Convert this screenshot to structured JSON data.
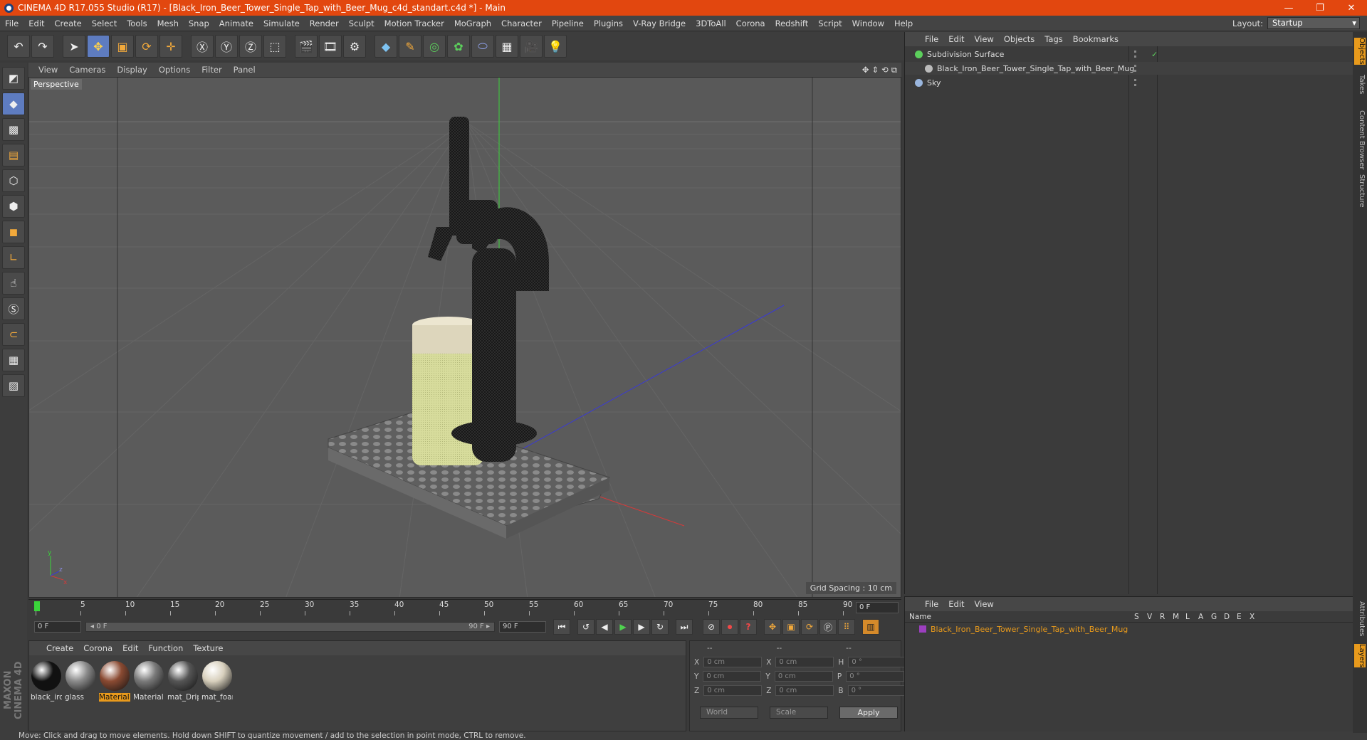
{
  "title": "CINEMA 4D R17.055 Studio (R17) - [Black_Iron_Beer_Tower_Single_Tap_with_Beer_Mug_c4d_standart.c4d *] - Main",
  "menus": [
    "File",
    "Edit",
    "Create",
    "Select",
    "Tools",
    "Mesh",
    "Snap",
    "Animate",
    "Simulate",
    "Render",
    "Sculpt",
    "Motion Tracker",
    "MoGraph",
    "Character",
    "Pipeline",
    "Plugins",
    "V-Ray Bridge",
    "3DToAll",
    "Corona",
    "Redshift",
    "Script",
    "Window",
    "Help"
  ],
  "layout": {
    "label": "Layout:",
    "value": "Startup"
  },
  "viewport": {
    "menus": [
      "View",
      "Cameras",
      "Display",
      "Options",
      "Filter",
      "Panel"
    ],
    "label": "Perspective",
    "grid_spacing": "Grid Spacing : 10 cm"
  },
  "timeline": {
    "ticks": [
      "0",
      "5",
      "10",
      "15",
      "20",
      "25",
      "30",
      "35",
      "40",
      "45",
      "50",
      "55",
      "60",
      "65",
      "70",
      "75",
      "80",
      "85",
      "90"
    ],
    "current_frame": "0 F",
    "start_field": "0 F",
    "slider_start": "◂ 0 F",
    "slider_end": "90 F ▸",
    "end_field": "90 F"
  },
  "material_manager": {
    "menus": [
      "Create",
      "Corona",
      "Edit",
      "Function",
      "Texture"
    ],
    "materials": [
      {
        "name": "black_iron",
        "color": "#111111"
      },
      {
        "name": "glass",
        "color": "#8a8a8a"
      },
      {
        "name": "Material",
        "color": "#8a4a32"
      },
      {
        "name": "Material",
        "color": "#7a7a7a"
      },
      {
        "name": "mat_Drip",
        "color": "#555555"
      },
      {
        "name": "mat_foam",
        "color": "#d8d0bd"
      }
    ]
  },
  "coords": {
    "headers": [
      "--",
      "--",
      "--"
    ],
    "rows": [
      {
        "a": "X",
        "av": "0 cm",
        "b": "X",
        "bv": "0 cm",
        "c": "H",
        "cv": "0 °"
      },
      {
        "a": "Y",
        "av": "0 cm",
        "b": "Y",
        "bv": "0 cm",
        "c": "P",
        "cv": "0 °"
      },
      {
        "a": "Z",
        "av": "0 cm",
        "b": "Z",
        "bv": "0 cm",
        "c": "B",
        "cv": "0 °"
      }
    ],
    "space": "World",
    "mode": "Scale",
    "apply": "Apply"
  },
  "object_manager": {
    "menus": [
      "File",
      "Edit",
      "View",
      "Objects",
      "Tags",
      "Bookmarks"
    ],
    "objects": [
      {
        "name": "Subdivision Surface",
        "icon_color": "#5ccf5c"
      },
      {
        "name": "Black_Iron_Beer_Tower_Single_Tap_with_Beer_Mug",
        "icon_color": "#bbbbbb"
      },
      {
        "name": "Sky",
        "icon_color": "#9ab6de"
      }
    ]
  },
  "attributes": {
    "menus": [
      "File",
      "Edit",
      "View"
    ],
    "columns": [
      "Name",
      "S",
      "V",
      "R",
      "M",
      "L",
      "A",
      "G",
      "D",
      "E",
      "X"
    ],
    "row": "Black_Iron_Beer_Tower_Single_Tap_with_Beer_Mug"
  },
  "side_tabs": [
    "Objects",
    "Takes",
    "Content Browser",
    "Structure",
    "Attributes",
    "Layers"
  ],
  "brand": "MAXON CINEMA 4D",
  "status": "Move: Click and drag to move elements. Hold down SHIFT to quantize movement / add to the selection in point mode, CTRL to remove."
}
